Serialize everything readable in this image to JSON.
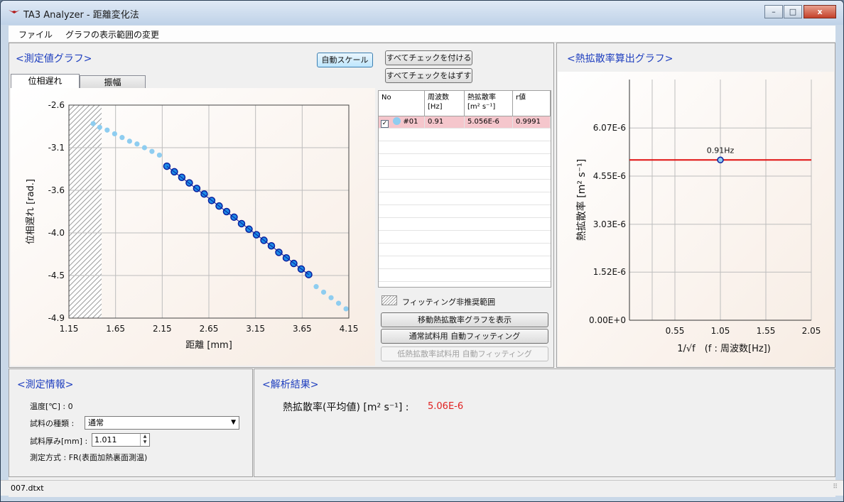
{
  "window": {
    "title": "TA3 Analyzer - 距離変化法",
    "minimize": "–",
    "maximize": "□",
    "close": "x"
  },
  "menu": {
    "file": "ファイル",
    "graph_range": "グラフの表示範囲の変更"
  },
  "measure_graph": {
    "title": "<測定値グラフ>",
    "tabs": [
      "位相遅れ",
      "振幅"
    ],
    "auto_scale": "自動スケール",
    "check_all": "すべてチェックを付ける",
    "uncheck_all": "すべてチェックをはずす"
  },
  "table": {
    "headers": [
      "No",
      "周波数\n[Hz]",
      "熱拡散率\n[m² s⁻¹]",
      "r値"
    ],
    "rows": [
      {
        "checked": true,
        "no": "#01",
        "freq": "0.91",
        "diff": "5.056E-6",
        "r": "0.9991"
      }
    ]
  },
  "fit": {
    "legend": "フィッティング非推奨範囲",
    "show_moving": "移動熱拡散率グラフを表示",
    "auto_fit_normal": "通常試料用 自動フィッティング",
    "auto_fit_low": "低熱拡散率試料用 自動フィッティング"
  },
  "diffusivity_graph": {
    "title": "<熱拡散率算出グラフ>"
  },
  "info": {
    "title": "<測定情報>",
    "temp_label": "温度[℃] : 0",
    "sample_type_label": "試料の種類 :",
    "sample_type_value": "通常",
    "thickness_label": "試料厚み[mm] :",
    "thickness_value": "1.011",
    "method_label": "測定方式 : FR(表面加熱裏面測温)"
  },
  "result": {
    "title": "<解析結果>",
    "label": "熱拡散率(平均値) [m² s⁻¹] :",
    "value": "5.06E-6"
  },
  "status": {
    "file": "007.dtxt"
  },
  "colors": {
    "accent": "#1f3fbf",
    "result": "#e02020",
    "fit_line": "#e01010",
    "selected_row": "#f5c6cc"
  },
  "chart_data": [
    {
      "type": "scatter",
      "title": "",
      "xlabel": "距離 [mm]",
      "ylabel": "位相遅れ [rad.]",
      "xlim": [
        1.15,
        4.15
      ],
      "ylim": [
        -4.9,
        -2.6
      ],
      "x_ticks": [
        "1.15",
        "1.65",
        "2.15",
        "2.65",
        "3.15",
        "3.65",
        "4.15"
      ],
      "y_ticks": [
        "-2.6",
        "-3.1",
        "-3.6",
        "-4.0",
        "-4.5",
        "-4.9"
      ],
      "hatched_range": [
        1.15,
        1.5
      ],
      "series": [
        {
          "name": "",
          "style": "light",
          "x": [
            1.41,
            1.48,
            1.56,
            1.64,
            1.72,
            1.8,
            1.88,
            1.96,
            2.04,
            2.12
          ],
          "y": [
            -2.8,
            -2.84,
            -2.87,
            -2.91,
            -2.95,
            -2.99,
            -3.02,
            -3.06,
            -3.1,
            -3.14
          ]
        },
        {
          "name": "",
          "style": "fitted",
          "x": [
            2.2,
            2.28,
            2.36,
            2.44,
            2.52,
            2.6,
            2.68,
            2.76,
            2.84,
            2.92,
            3.0,
            3.08,
            3.16,
            3.24,
            3.32,
            3.4,
            3.48,
            3.56,
            3.64,
            3.72
          ],
          "y": [
            -3.26,
            -3.32,
            -3.38,
            -3.44,
            -3.5,
            -3.56,
            -3.63,
            -3.69,
            -3.75,
            -3.81,
            -3.88,
            -3.94,
            -4.0,
            -4.06,
            -4.12,
            -4.19,
            -4.25,
            -4.31,
            -4.37,
            -4.43
          ]
        },
        {
          "name": "",
          "style": "light",
          "x": [
            3.8,
            3.88,
            3.96,
            4.04,
            4.12
          ],
          "y": [
            -4.56,
            -4.62,
            -4.68,
            -4.74,
            -4.8
          ]
        }
      ]
    },
    {
      "type": "scatter",
      "title": "",
      "xlabel": "1/√f　(f : 周波数[Hz])",
      "ylabel": "熱拡散率 [m² s⁻¹]",
      "xlim": [
        0.05,
        2.05
      ],
      "ylim": [
        0.0,
        7.6e-06
      ],
      "x_ticks": [
        "0.55",
        "1.05",
        "1.55",
        "2.05"
      ],
      "y_ticks": [
        "0.00E+0",
        "1.52E-6",
        "3.03E-6",
        "4.55E-6",
        "6.07E-6"
      ],
      "points": [
        {
          "x": 1.05,
          "y": 5.06e-06,
          "label": "0.91Hz"
        }
      ],
      "hline": 5.06e-06
    }
  ]
}
